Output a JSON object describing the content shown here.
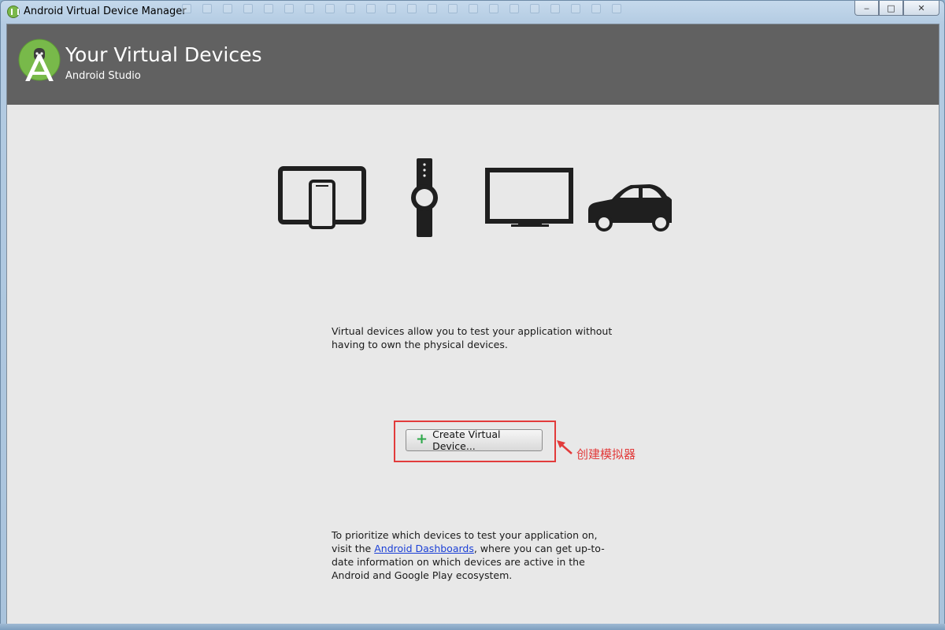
{
  "window": {
    "title": "Android Virtual Device Manager",
    "controls": {
      "minimize": "‒",
      "maximize": "□",
      "close": "✕"
    }
  },
  "header": {
    "title": "Your Virtual Devices",
    "subtitle": "Android Studio",
    "logo_icon": "android-studio-icon",
    "background_color": "#616161"
  },
  "device_icons": [
    "tablet-phone-icon",
    "watch-icon",
    "tv-icon",
    "car-icon"
  ],
  "description": "Virtual devices allow you to test your application without having to own the physical devices.",
  "create_button": {
    "label": "Create Virtual Device...",
    "icon": "plus-icon",
    "icon_color": "#2ea84a"
  },
  "annotation": {
    "text": "创建模拟器",
    "color": "#e23b3b"
  },
  "info": {
    "before_link": "To prioritize which devices to test your application on, visit the ",
    "link_text": "Android Dashboards",
    "after_link": ", where you can get up-to-date information on which devices are active in the Android and Google Play ecosystem."
  }
}
